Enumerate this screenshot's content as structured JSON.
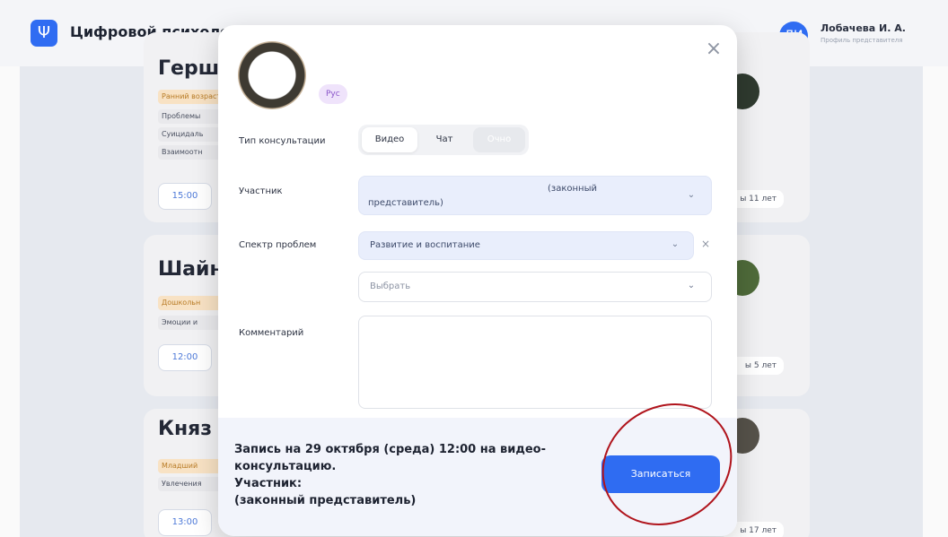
{
  "header": {
    "logo_glyph": "Ψ",
    "app_title": "Цифровой психолог",
    "user_initials": "ЛИ",
    "user_name": "Лобачева И. А.",
    "user_role": "Профиль представителя"
  },
  "cards": [
    {
      "name_fragment": "Герш",
      "tags": [
        "Ранний возраст",
        "Проблемы",
        "Суицидаль",
        "Взаимоотн"
      ],
      "time": "15:00",
      "age": "ы 11 лет"
    },
    {
      "name_fragment": "Шайн",
      "tags": [
        "Дошкольн",
        "Эмоции и"
      ],
      "time": "12:00",
      "age": "ы 5 лет"
    },
    {
      "name_fragment": "Княз",
      "tags": [
        "Младший",
        "Увлечения"
      ],
      "time": "13:00",
      "age": "ы 17 лет"
    }
  ],
  "modal": {
    "language_badge": "Рус",
    "close_glyph": "×",
    "consultation_type": {
      "label": "Тип консультации",
      "options": [
        "Видео",
        "Чат",
        "Очно"
      ],
      "selected": "Видео"
    },
    "participant": {
      "label": "Участник",
      "value_line1": "(законный",
      "value_line2": "представитель)"
    },
    "problems": {
      "label": "Спектр проблем",
      "selected_value": "Развитие и воспитание",
      "clear_glyph": "×",
      "add_placeholder": "Выбрать"
    },
    "comment": {
      "label": "Комментарий",
      "value": ""
    },
    "footer": {
      "summary_line1": "Запись на 29 октября (среда) 12:00 на видео-",
      "summary_line2": "консультацию.",
      "summary_line3": "Участник:",
      "summary_line4": "(законный представитель)",
      "submit_label": "Записаться"
    }
  },
  "colors": {
    "accent": "#2f6cf2",
    "annotation": "#b0141c"
  }
}
